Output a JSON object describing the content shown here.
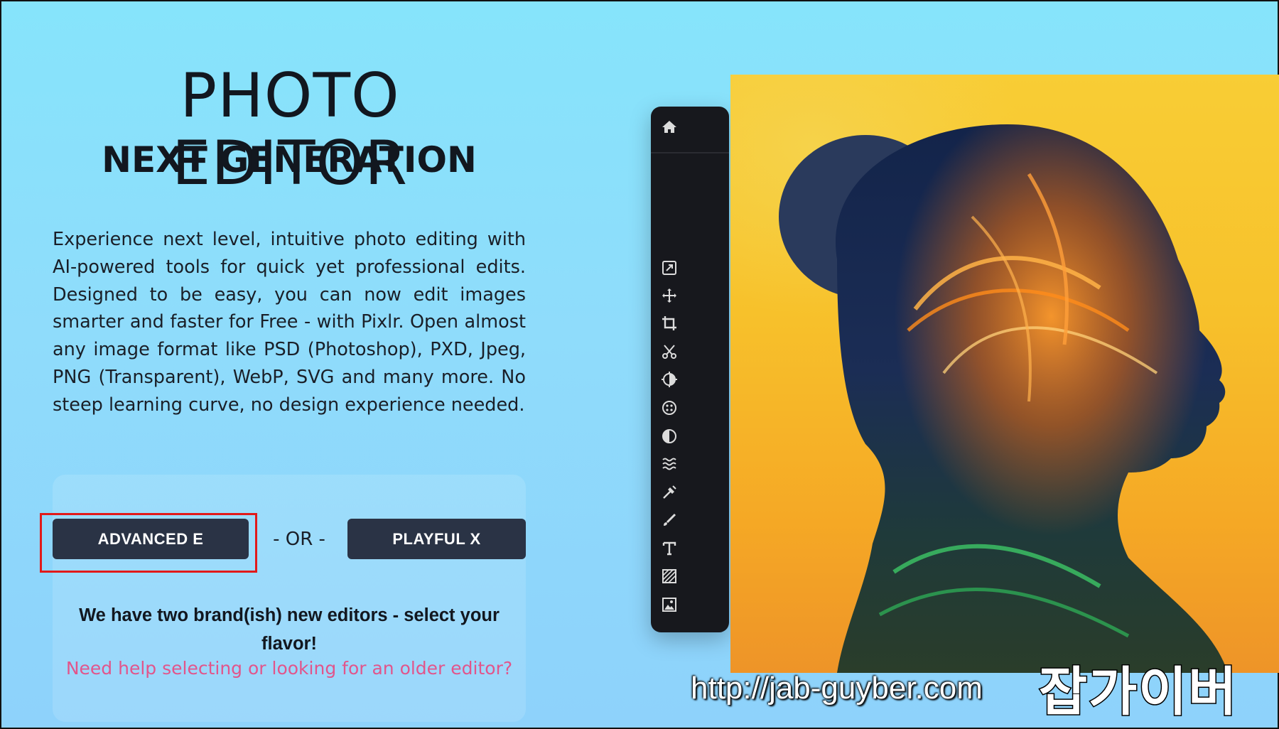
{
  "hero": {
    "title": "PHOTO EDITOR",
    "subtitle": "NEXT GENERATION",
    "description": "Experience next level, intuitive photo editing with AI-powered tools for quick yet professional edits. Designed to be easy, you can now edit images smarter and faster for Free - with Pixlr. Open almost any image format like PSD (Photoshop), PXD, Jpeg, PNG (Transparent), WebP, SVG and many more. No steep learning curve, no design experience needed."
  },
  "choice": {
    "advanced_label": "ADVANCED E",
    "or_label": "- OR -",
    "playful_label": "PLAYFUL X",
    "tagline": "We have two brand(ish) new editors - select your flavor!",
    "help_link": "Need help selecting or looking for an older editor?"
  },
  "toolbar": {
    "tools": [
      "home-icon",
      "arrange-icon",
      "move-icon",
      "crop-icon",
      "cutout-icon",
      "adjust-icon",
      "filter-icon",
      "dodge-burn-icon",
      "liquify-icon",
      "heal-icon",
      "draw-icon",
      "text-icon",
      "pattern-icon",
      "image-icon"
    ]
  },
  "watermark": {
    "url": "http://jab-guyber.com",
    "brand": "잡가이버"
  },
  "colors": {
    "button_bg": "#2a3345",
    "link": "#e2558b",
    "highlight": "#e11a1a",
    "toolbar_bg": "#17181d"
  }
}
